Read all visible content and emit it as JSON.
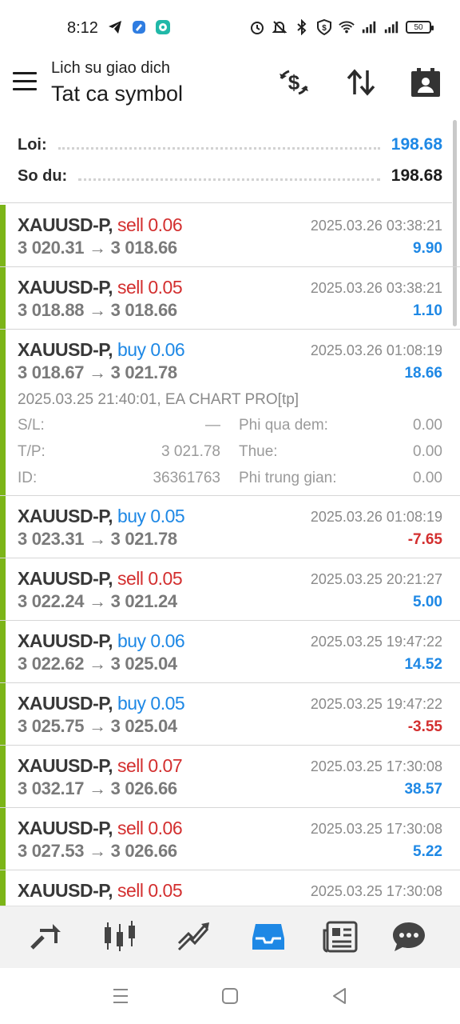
{
  "status_bar": {
    "time": "8:12",
    "battery": "50",
    "left_icons": [
      "telegram-icon",
      "app-icon",
      "messenger-icon"
    ],
    "right_icons": [
      "alarm-icon",
      "mute-icon",
      "bluetooth-icon",
      "vpn-icon",
      "wifi-icon",
      "signal-icon",
      "signal-icon"
    ]
  },
  "header": {
    "subtitle": "Lich su giao dich",
    "title": "Tat ca symbol",
    "actions": [
      "currency-exchange-icon",
      "sort-icon",
      "calendar-icon"
    ]
  },
  "summary": {
    "profit_label": "Loi:",
    "profit_value": "198.68",
    "balance_label": "So du:",
    "balance_value": "198.68",
    "colors": {
      "profit": "#1e88e5",
      "balance": "#1c1c1c"
    }
  },
  "deals": [
    {
      "symbol": "XAUUSD-P,",
      "type": "sell",
      "volume": "0.06",
      "open": "3 020.31",
      "close": "3 018.66",
      "time": "2025.03.26 03:38:21",
      "profit": "9.90"
    },
    {
      "symbol": "XAUUSD-P,",
      "type": "sell",
      "volume": "0.05",
      "open": "3 018.88",
      "close": "3 018.66",
      "time": "2025.03.26 03:38:21",
      "profit": "1.10"
    },
    {
      "symbol": "XAUUSD-P,",
      "type": "buy",
      "volume": "0.06",
      "open": "3 018.67",
      "close": "3 021.78",
      "time": "2025.03.26 01:08:19",
      "profit": "18.66",
      "details": {
        "comment": "2025.03.25 21:40:01, EA CHART PRO[tp]",
        "sl_label": "S/L:",
        "sl_value": "—",
        "swap_label": "Phi qua dem:",
        "swap_value": "0.00",
        "tp_label": "T/P:",
        "tp_value": "3 021.78",
        "tax_label": "Thue:",
        "tax_value": "0.00",
        "id_label": "ID:",
        "id_value": "36361763",
        "commission_label": "Phi trung gian:",
        "commission_value": "0.00"
      }
    },
    {
      "symbol": "XAUUSD-P,",
      "type": "buy",
      "volume": "0.05",
      "open": "3 023.31",
      "close": "3 021.78",
      "time": "2025.03.26 01:08:19",
      "profit": "-7.65"
    },
    {
      "symbol": "XAUUSD-P,",
      "type": "sell",
      "volume": "0.05",
      "open": "3 022.24",
      "close": "3 021.24",
      "time": "2025.03.25 20:21:27",
      "profit": "5.00"
    },
    {
      "symbol": "XAUUSD-P,",
      "type": "buy",
      "volume": "0.06",
      "open": "3 022.62",
      "close": "3 025.04",
      "time": "2025.03.25 19:47:22",
      "profit": "14.52"
    },
    {
      "symbol": "XAUUSD-P,",
      "type": "buy",
      "volume": "0.05",
      "open": "3 025.75",
      "close": "3 025.04",
      "time": "2025.03.25 19:47:22",
      "profit": "-3.55"
    },
    {
      "symbol": "XAUUSD-P,",
      "type": "sell",
      "volume": "0.07",
      "open": "3 032.17",
      "close": "3 026.66",
      "time": "2025.03.25 17:30:08",
      "profit": "38.57"
    },
    {
      "symbol": "XAUUSD-P,",
      "type": "sell",
      "volume": "0.06",
      "open": "3 027.53",
      "close": "3 026.66",
      "time": "2025.03.25 17:30:08",
      "profit": "5.22"
    },
    {
      "symbol": "XAUUSD-P,",
      "type": "sell",
      "volume": "0.05",
      "open": "",
      "close": "",
      "time": "2025.03.25 17:30:08",
      "profit": ""
    }
  ],
  "colors": {
    "sell": "#d32f2f",
    "buy": "#1e88e5",
    "positive": "#1e88e5",
    "negative": "#d32f2f",
    "accent": "#7cb518",
    "active_tab": "#1e88e5"
  },
  "bottom_nav": [
    "quotes-icon",
    "chart-icon",
    "trade-icon",
    "history-icon",
    "news-icon",
    "chat-icon"
  ],
  "bottom_nav_active": "history-icon",
  "system_nav": [
    "recent-apps-icon",
    "home-icon",
    "back-icon"
  ]
}
